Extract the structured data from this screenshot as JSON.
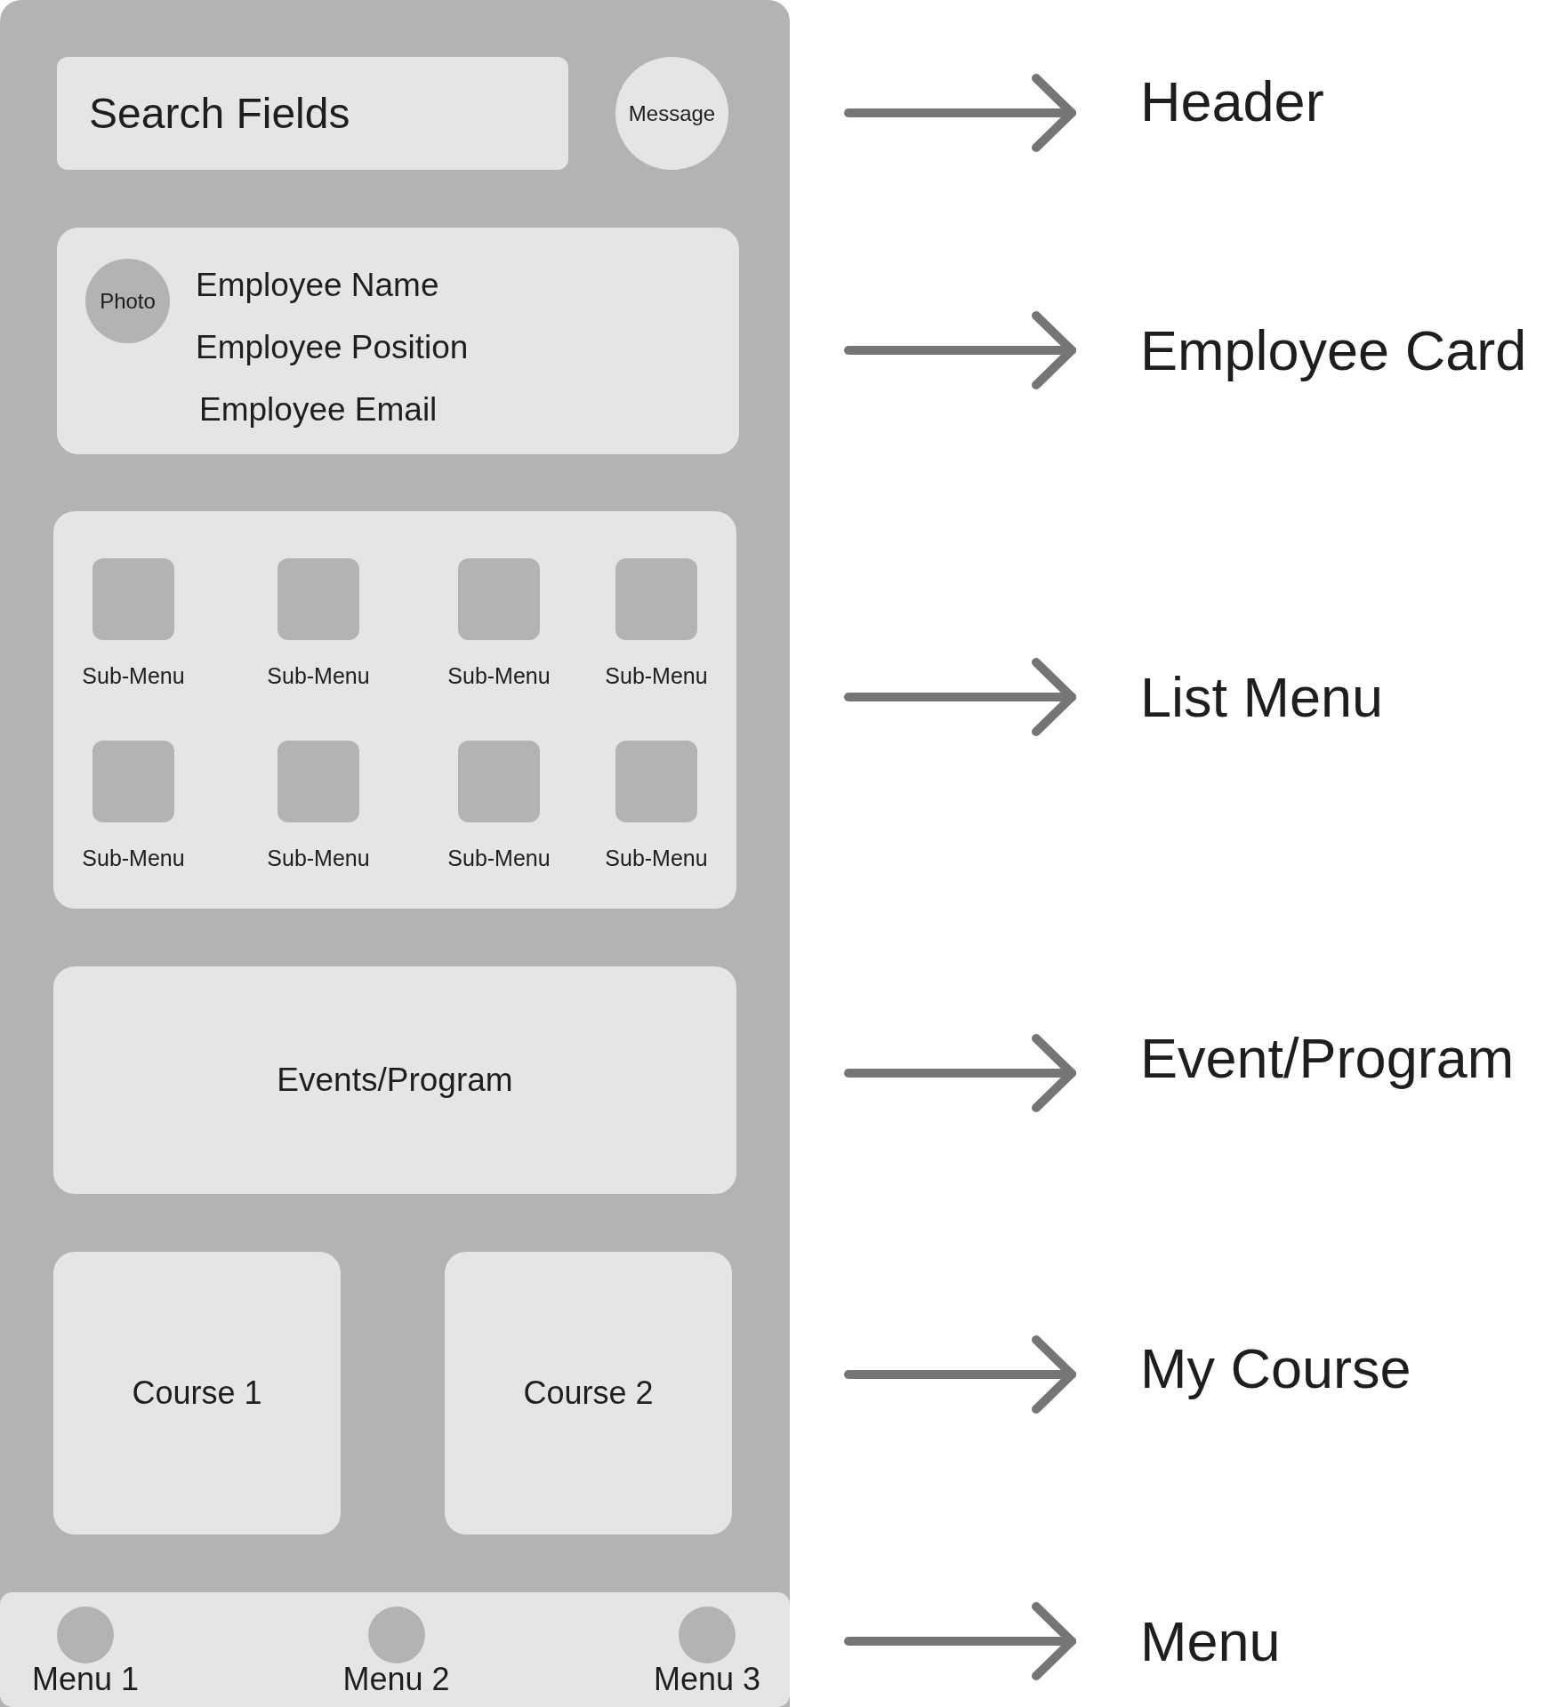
{
  "header": {
    "search": {
      "placeholder": "Search Fields"
    },
    "message_button": "Message"
  },
  "employee_card": {
    "photo": "Photo",
    "name": "Employee Name",
    "position": "Employee Position",
    "email": "Employee Email"
  },
  "list_menu": {
    "items": [
      {
        "label": "Sub-Menu"
      },
      {
        "label": "Sub-Menu"
      },
      {
        "label": "Sub-Menu"
      },
      {
        "label": "Sub-Menu"
      },
      {
        "label": "Sub-Menu"
      },
      {
        "label": "Sub-Menu"
      },
      {
        "label": "Sub-Menu"
      },
      {
        "label": "Sub-Menu"
      }
    ]
  },
  "events": {
    "label": "Events/Program"
  },
  "courses": [
    {
      "label": "Course 1"
    },
    {
      "label": "Course 2"
    }
  ],
  "bottom_menu": {
    "items": [
      {
        "label": "Menu 1"
      },
      {
        "label": "Menu 2"
      },
      {
        "label": "Menu 3"
      }
    ]
  },
  "annotations": [
    {
      "label": "Header"
    },
    {
      "label": "Employee Card"
    },
    {
      "label": "List Menu"
    },
    {
      "label": "Event/Program"
    },
    {
      "label": "My Course"
    },
    {
      "label": "Menu"
    }
  ]
}
